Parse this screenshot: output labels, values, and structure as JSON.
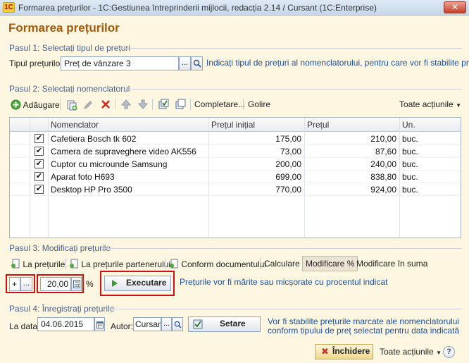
{
  "window": {
    "title": "Formarea prețurilor - 1C:Gestiunea întreprinderii mijlocii, redacția 2.14 / Cursant  (1C:Enterprise)",
    "logo": "1C",
    "close_glyph": "✕"
  },
  "page_title": "Formarea prețurilor",
  "step1": {
    "section": "Pasul 1: Selectați tipul de prețuri",
    "field_label": "Tipul prețurilor:",
    "field_value": "Preț de vânzare 3",
    "hint": "Indicați tipul de prețuri al nomenclatorului, pentru care vor fi stabilite prețurile"
  },
  "step2": {
    "section": "Pasul 2: Selectați nomenclatorul",
    "toolbar": {
      "add": "Adăugare",
      "complete": "Completare...",
      "clear": "Golire",
      "all_actions": "Toate acțiunile"
    },
    "columns": [
      "Nomenclator",
      "Prețul inițial",
      "Prețul",
      "Un."
    ],
    "rows": [
      {
        "name": "Cafetiera Bosch tk 602",
        "initial": "175,00",
        "price": "210,00",
        "unit": "buc.",
        "checked": "✔"
      },
      {
        "name": "Camera de supraveghere video AK556",
        "initial": "73,00",
        "price": "87,60",
        "unit": "buc.",
        "checked": "✔"
      },
      {
        "name": "Cuptor cu microunde Samsung",
        "initial": "200,00",
        "price": "240,00",
        "unit": "buc.",
        "checked": "✔"
      },
      {
        "name": "Aparat foto H693",
        "initial": "699,00",
        "price": "838,80",
        "unit": "buc.",
        "checked": "✔"
      },
      {
        "name": "Desktop HP Pro 3500",
        "initial": "770,00",
        "price": "924,00",
        "unit": "buc.",
        "checked": "✔"
      }
    ]
  },
  "step3": {
    "section": "Pasul 3: Modificați prețurile",
    "tabs": [
      "La prețurile",
      "La prețurile partenerului",
      "Conform documentului",
      "Calculare",
      "Modificare %",
      "Modificare în suma"
    ],
    "sign": "+",
    "percent_value": "20,00",
    "percent_sign": "%",
    "execute": "Executare",
    "hint": "Prețurile vor fi mărite sau micșorate cu procentul indicat"
  },
  "step4": {
    "section": "Pasul 4: Înregistrați prețurile",
    "date_label": "La data:",
    "date_value": "04.06.2015",
    "author_label": "Autor:",
    "author_value": "Cursant",
    "set_button": "Setare",
    "hint_line1": "Vor fi stabilite prețurile marcate ale nomenclatorului",
    "hint_line2": "conform tipului de preț selectat pentru data indicată"
  },
  "footer": {
    "close": "Închidere",
    "all_actions": "Toate acțiunile",
    "help": "?"
  },
  "ellipsis": "...",
  "colors": {
    "title": "#a55a09",
    "section": "#4a5f8c",
    "link": "#1c4fa3",
    "highlight": "#d01010"
  }
}
